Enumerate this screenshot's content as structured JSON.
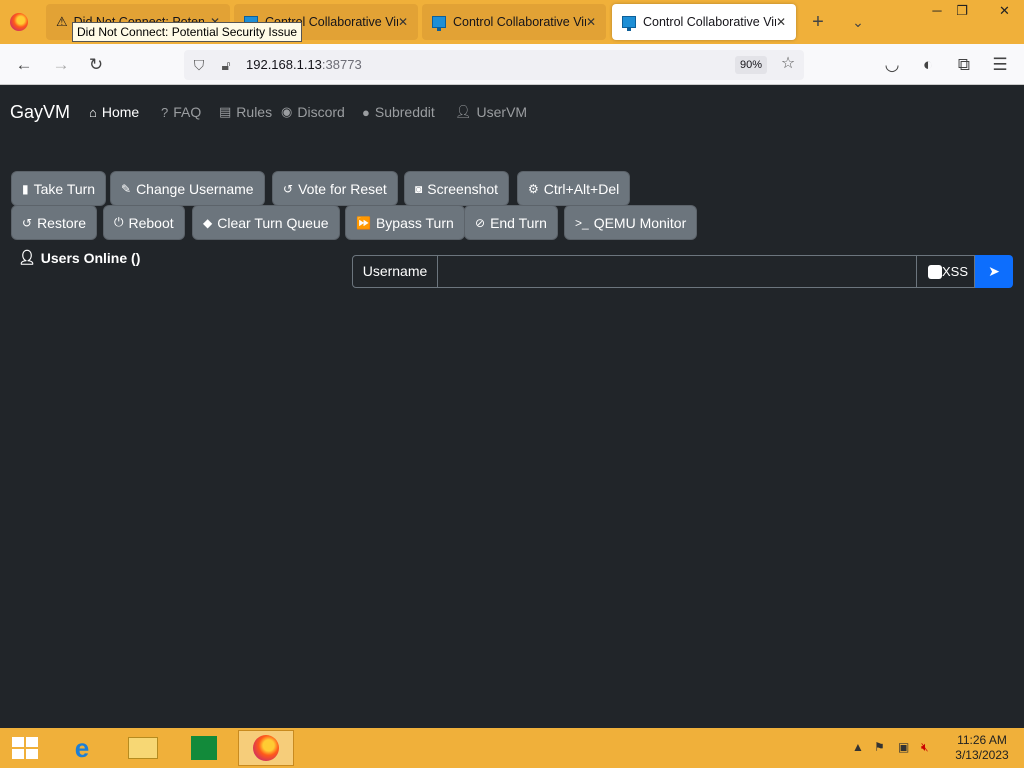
{
  "browser": {
    "tabs": [
      {
        "label": "Did Not Connect: Potential Security Issue",
        "favicon": "warning-icon",
        "active": false
      },
      {
        "label": "Control Collaborative Virtual Machines!",
        "favicon": "monitor-icon",
        "active": false
      },
      {
        "label": "Control Collaborative Virtual Machines!",
        "favicon": "monitor-icon",
        "active": false
      },
      {
        "label": "Control Collaborative Virtual Machines!",
        "favicon": "monitor-icon",
        "active": true
      }
    ],
    "tooltip": "Did Not Connect: Potential Security Issue",
    "url_host": "192.168.1.13",
    "url_port": ":38773",
    "zoom": "90%"
  },
  "site": {
    "brand": "GayVM",
    "nav": [
      {
        "label": "Home",
        "icon": "home-icon",
        "active": true
      },
      {
        "label": "FAQ",
        "icon": "question-circle-icon",
        "active": false
      },
      {
        "label": "Rules",
        "icon": "clipboard-icon",
        "active": false
      },
      {
        "label": "Discord",
        "icon": "discord-icon",
        "active": false
      },
      {
        "label": "Subreddit",
        "icon": "reddit-icon",
        "active": false
      },
      {
        "label": "UserVM",
        "icon": "user-icon",
        "active": false
      }
    ],
    "buttons_row1": [
      {
        "label": "Take Turn",
        "icon": "mouse-icon"
      },
      {
        "label": "Change Username",
        "icon": "user-edit-icon"
      },
      {
        "label": "Vote for Reset",
        "icon": "undo-icon"
      },
      {
        "label": "Screenshot",
        "icon": "camera-icon"
      },
      {
        "label": "Ctrl+Alt+Del",
        "icon": "gear-icon"
      }
    ],
    "buttons_row2": [
      {
        "label": "Restore",
        "icon": "undo-icon"
      },
      {
        "label": "Reboot",
        "icon": "power-icon"
      },
      {
        "label": "Clear Turn Queue",
        "icon": "eraser-icon"
      },
      {
        "label": "Bypass Turn",
        "icon": "fast-forward-icon"
      },
      {
        "label": "End Turn",
        "icon": "ban-icon"
      },
      {
        "label": "QEMU Monitor",
        "icon": "terminal-icon"
      }
    ],
    "users_online": "Users Online ()",
    "chat": {
      "username_label": "Username",
      "message_value": "",
      "xss_label": "XSS",
      "xss_checked": false
    }
  },
  "taskbar": {
    "time": "11:26 AM",
    "date": "3/13/2023"
  },
  "colors": {
    "page_bg": "#212529",
    "button_bg": "#6c757d",
    "send_bg": "#0d6efd",
    "chrome_accent": "#f0b03a"
  }
}
